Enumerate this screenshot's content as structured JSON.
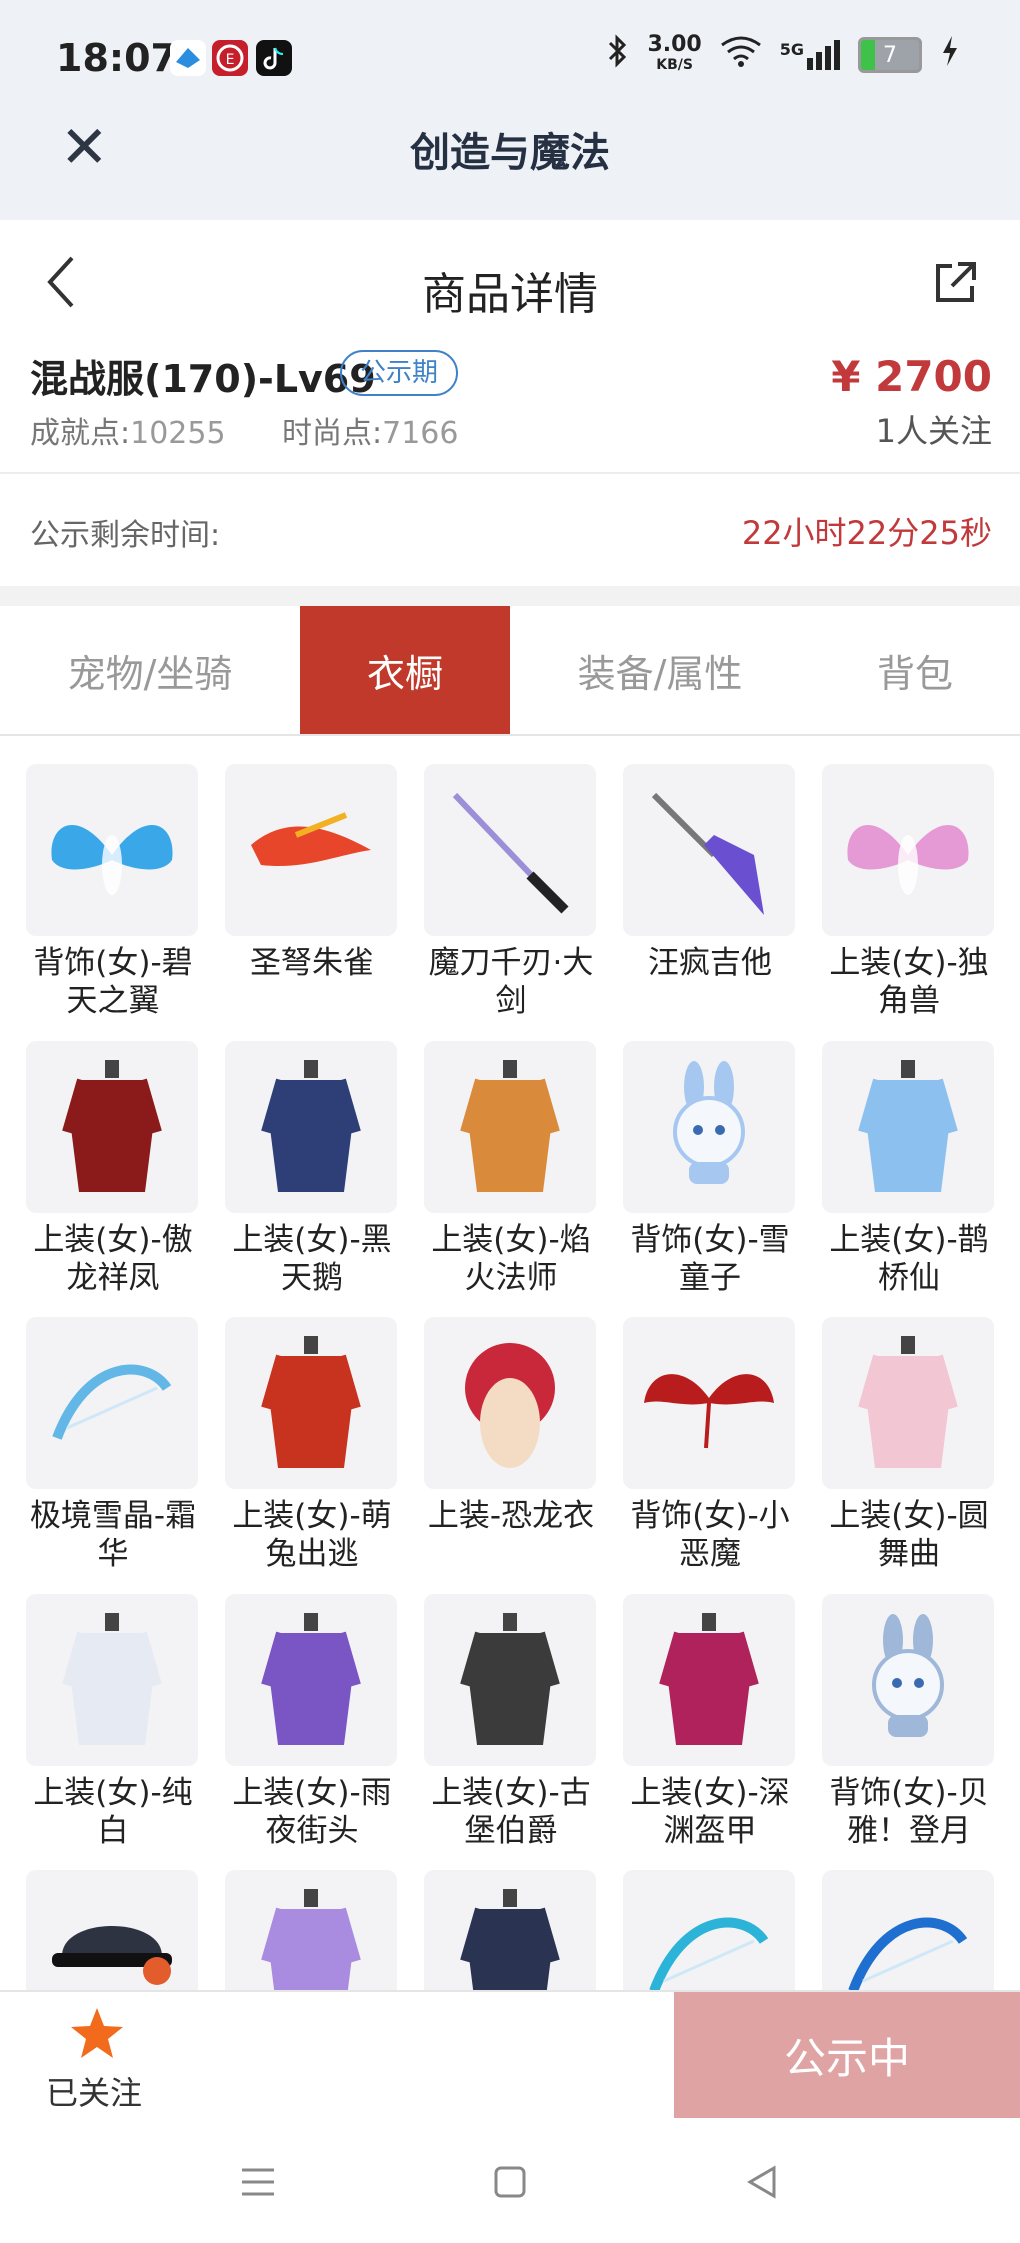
{
  "status": {
    "time": "18:07",
    "speed_top": "3.00",
    "speed_unit": "KB/S",
    "network": "5G",
    "battery": "7"
  },
  "app": {
    "title": "创造与魔法"
  },
  "nav": {
    "title": "商品详情"
  },
  "product": {
    "name": "混战服(170)-Lv69",
    "badge": "公示期",
    "price": "¥ 2700",
    "achievement_label": "成就点:",
    "achievement_value": "10255",
    "fashion_label": "时尚点:",
    "fashion_value": "7166",
    "followers": "1人关注"
  },
  "countdown": {
    "label": "公示剩余时间:",
    "value": "22小时22分25秒"
  },
  "tabs": [
    {
      "label": "宠物/坐骑",
      "active": false
    },
    {
      "label": "衣橱",
      "active": true
    },
    {
      "label": "装备/属性",
      "active": false
    },
    {
      "label": "背包",
      "active": false
    }
  ],
  "items": [
    {
      "name": "背饰(女)-碧天之翼",
      "icon": "blue-wings-icon",
      "color": "#3aa7e8"
    },
    {
      "name": "圣弩朱雀",
      "icon": "phoenix-crossbow-icon",
      "color": "#e8462b"
    },
    {
      "name": "魔刀千刃·大剑",
      "icon": "katana-icon",
      "color": "#222222"
    },
    {
      "name": "汪疯吉他",
      "icon": "guitar-icon",
      "color": "#6a4fd0"
    },
    {
      "name": "上装(女)-独角兽",
      "icon": "rainbow-wings-dress-icon",
      "color": "#e59ad6"
    },
    {
      "name": "上装(女)-傲龙祥凤",
      "icon": "red-black-outfit-icon",
      "color": "#8b1a1a"
    },
    {
      "name": "上装(女)-黑天鹅",
      "icon": "navy-dress-icon",
      "color": "#2e3f78"
    },
    {
      "name": "上装(女)-焰火法师",
      "icon": "mage-robe-icon",
      "color": "#d98a3a"
    },
    {
      "name": "背饰(女)-雪童子",
      "icon": "snow-bunny-icon",
      "color": "#a6c8f0"
    },
    {
      "name": "上装(女)-鹊桥仙",
      "icon": "light-blue-dress-icon",
      "color": "#8cc0ee"
    },
    {
      "name": "极境雪晶-霜华",
      "icon": "ice-bow-icon",
      "color": "#62b7e6"
    },
    {
      "name": "上装(女)-萌兔出逃",
      "icon": "red-coat-icon",
      "color": "#c8331f"
    },
    {
      "name": "上装-恐龙衣",
      "icon": "dino-costume-icon",
      "color": "#c9283a"
    },
    {
      "name": "背饰(女)-小恶魔",
      "icon": "devil-wings-icon",
      "color": "#b91c1c"
    },
    {
      "name": "上装(女)-圆舞曲",
      "icon": "pink-gown-icon",
      "color": "#f3c6d3"
    },
    {
      "name": "上装(女)-纯白",
      "icon": "white-gown-icon",
      "color": "#e6eaf2"
    },
    {
      "name": "上装(女)-雨夜街头",
      "icon": "purple-jacket-icon",
      "color": "#7a55c4"
    },
    {
      "name": "上装(女)-古堡伯爵",
      "icon": "gothic-dress-icon",
      "color": "#3b3b3b"
    },
    {
      "name": "上装(女)-深渊盔甲",
      "icon": "abyss-armor-icon",
      "color": "#b0225b"
    },
    {
      "name": "背饰(女)-贝雅！登月",
      "icon": "astronaut-bunny-icon",
      "color": "#9fb7d8"
    },
    {
      "name": "",
      "icon": "cap-headphones-icon",
      "color": "#2d3340"
    },
    {
      "name": "",
      "icon": "lavender-gown-icon",
      "color": "#a98be0"
    },
    {
      "name": "",
      "icon": "navy-uniform-icon",
      "color": "#2a3352"
    },
    {
      "name": "",
      "icon": "cyan-blade-icon",
      "color": "#2bb3d8"
    },
    {
      "name": "",
      "icon": "scythe-icon",
      "color": "#1f6fd0"
    }
  ],
  "bottom": {
    "followed_label": "已关注",
    "action_label": "公示中"
  },
  "colors": {
    "accent": "#c0392b",
    "price": "#c1393b",
    "badge": "#3f82c7",
    "star": "#f26a1b"
  }
}
